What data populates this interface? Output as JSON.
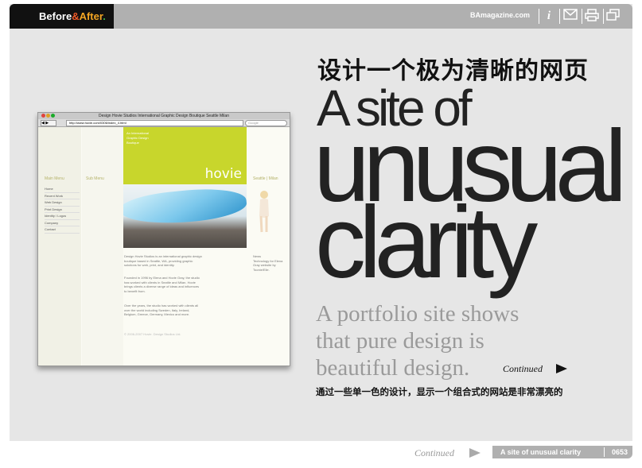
{
  "header": {
    "logo": {
      "before": "Before",
      "amp": "&",
      "after": "After",
      "dot": "."
    },
    "site": "BAmagazine.com",
    "icons": [
      "info-icon",
      "mail-icon",
      "print-icon",
      "window-icon"
    ],
    "info_glyph": "i"
  },
  "browser": {
    "title": "Design Hovie Studios International Graphic Design Boutique Seattle Milan",
    "nav": "◀ ▶",
    "url": "http://www.hovie.com/0306/index_4.html",
    "search_placeholder": "Google",
    "main_menu_label": "Main Menu",
    "sub_menu_label": "Sub Menu",
    "menu_items": [
      "Home",
      "Recent Work",
      "Web Design",
      "Print Design",
      "Identity / Logos",
      "Company",
      "Contact"
    ],
    "hero_tagline": "An International\nGraphic Design\nBoutique",
    "hero_brand": "hovie",
    "right_label": "Seattle | Milan",
    "body_text_1": "Design Hovie Studios is an international graphic design boutique based in Seattle, WA, providing graphic solutions for web, print, and identity.",
    "body_text_2": "Founded in 1996 by Elena and Hovie Gray, the studio has worked with clients in Seattle and Milan. Hovie brings clients a diverse range of ideas and influences to benefit from.",
    "body_text_3": "Over the years, the studio has worked with clients all over the world including Sweden, Italy, Ireland, Belgium, Greece, Germany, Mexico and more.",
    "copyright": "© 2006-2007 Hovie. Design Studios Ltd.",
    "right_note": "News\nTechnology for Elena Gray website by Toonie/Elle."
  },
  "article": {
    "title_cn": "设计一个极为清晰的网页",
    "headline_1": "A site of",
    "headline_2": "unusual",
    "headline_3": "clarity",
    "deck_1": "A portfolio site shows",
    "deck_2": "that pure design is",
    "deck_3": "beautiful design.",
    "continued": "Continued",
    "subtitle_cn": "通过一些单一色的设计，显示一个组合式的网站是非常漂亮的"
  },
  "footer": {
    "continued": "Continued",
    "title": "A site of unusual clarity",
    "page": "0653"
  }
}
